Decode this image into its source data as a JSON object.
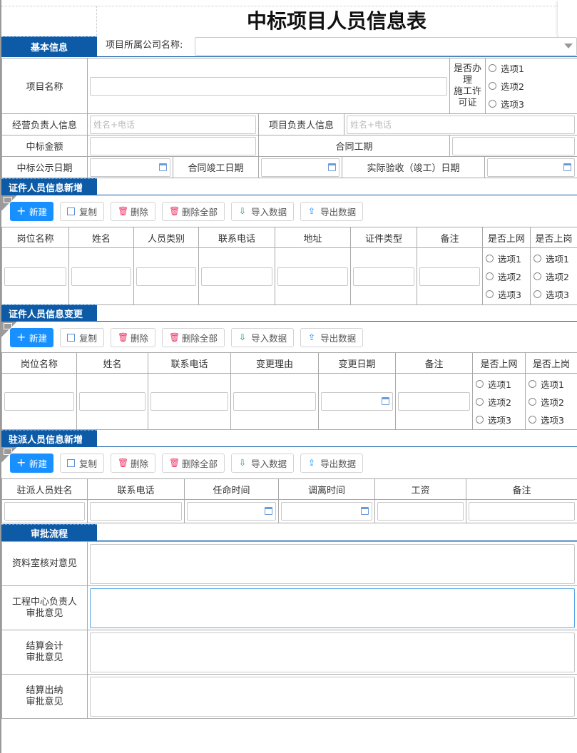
{
  "title": "中标项目人员信息表",
  "basic": {
    "section": "基本信息",
    "company_label": "项目所属公司名称:",
    "project_name_label": "项目名称",
    "permit_label_1": "是否办理",
    "permit_label_2": "施工许可证",
    "permit_options": [
      "选项1",
      "选项2",
      "选项3"
    ],
    "biz_leader_label": "经营负责人信息",
    "biz_leader_placeholder": "姓名+电话",
    "proj_leader_label": "项目负责人信息",
    "proj_leader_placeholder": "姓名+电话",
    "bid_amount_label": "中标金额",
    "contract_period_label": "合同工期",
    "publicity_date_label": "中标公示日期",
    "completion_date_label": "合同竣工日期",
    "acceptance_date_label": "实际验收（竣工）日期"
  },
  "toolbar": {
    "new": "新建",
    "copy": "复制",
    "delete": "删除",
    "delete_all": "删除全部",
    "import": "导入数据",
    "export": "导出数据"
  },
  "cert_add": {
    "section": "证件人员信息新增",
    "columns": [
      "岗位名称",
      "姓名",
      "人员类别",
      "联系电话",
      "地址",
      "证件类型",
      "备注",
      "是否上网",
      "是否上岗"
    ],
    "options": [
      "选项1",
      "选项2",
      "选项3"
    ]
  },
  "cert_change": {
    "section": "证件人员信息变更",
    "columns": [
      "岗位名称",
      "姓名",
      "联系电话",
      "变更理由",
      "变更日期",
      "备注",
      "是否上网",
      "是否上岗"
    ],
    "options": [
      "选项1",
      "选项2",
      "选项3"
    ]
  },
  "resident": {
    "section": "驻派人员信息新增",
    "columns": [
      "驻派人员姓名",
      "联系电话",
      "任命时间",
      "调离时间",
      "工资",
      "备注"
    ]
  },
  "approval": {
    "section": "审批流程",
    "rows": [
      {
        "l1": "资料室核对意见",
        "l2": ""
      },
      {
        "l1": "工程中心负责人",
        "l2": "审批意见"
      },
      {
        "l1": "结算会计",
        "l2": "审批意见"
      },
      {
        "l1": "结算出纳",
        "l2": "审批意见"
      }
    ]
  }
}
